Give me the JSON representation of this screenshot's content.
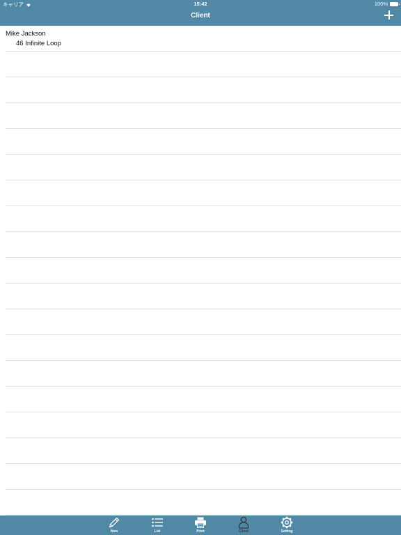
{
  "status": {
    "carrier": "キャリア",
    "time": "15:42",
    "battery": "100%"
  },
  "nav": {
    "title": "Client",
    "add_icon": "plus-icon"
  },
  "clients": [
    {
      "name": "Mike Jackson",
      "address": "46 Infinite Loop"
    }
  ],
  "tabs": [
    {
      "label": "New",
      "icon": "pencil-icon",
      "active": false
    },
    {
      "label": "List",
      "icon": "list-icon",
      "active": false
    },
    {
      "label": "Print",
      "icon": "printer-icon",
      "active": false
    },
    {
      "label": "Client",
      "icon": "person-icon",
      "active": true
    },
    {
      "label": "Setting",
      "icon": "gear-icon",
      "active": false
    }
  ],
  "colors": {
    "bar": "#5088a6",
    "separator": "#e1e1e1",
    "active_tab": "#2e3a42"
  }
}
